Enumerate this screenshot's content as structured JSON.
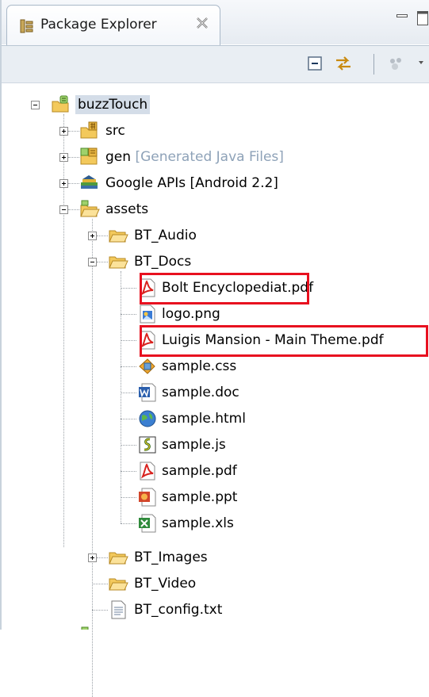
{
  "view": {
    "tab_label": "Package Explorer",
    "tab_icon": "package-explorer-icon",
    "close_icon": "close-x-icon"
  },
  "toolbar": {
    "buttons": [
      "collapse-all-icon",
      "link-with-editor-icon",
      "focus-icon",
      "view-menu-icon"
    ]
  },
  "tree": {
    "project": {
      "label": "buzzTouch",
      "icon": "android-project-icon",
      "expanded": true
    },
    "src": {
      "label": "src",
      "icon": "source-folder-icon"
    },
    "gen": {
      "label": "gen",
      "decoration": "[Generated Java Files]",
      "icon": "source-folder-icon"
    },
    "google_apis": {
      "label": "Google APIs [Android 2.2]",
      "icon": "library-icon"
    },
    "assets": {
      "label": "assets",
      "icon": "folder-icon"
    },
    "bt_audio": {
      "label": "BT_Audio",
      "icon": "folder-icon"
    },
    "bt_docs": {
      "label": "BT_Docs",
      "icon": "folder-icon"
    },
    "files": [
      {
        "label": "Bolt Encyclopediat.pdf",
        "icon": "pdf-icon",
        "highlighted": true
      },
      {
        "label": "logo.png",
        "icon": "image-icon",
        "highlighted": false
      },
      {
        "label": "Luigis Mansion - Main Theme.pdf",
        "icon": "pdf-icon",
        "highlighted": true
      },
      {
        "label": "sample.css",
        "icon": "css-icon",
        "highlighted": false
      },
      {
        "label": "sample.doc",
        "icon": "word-doc-icon",
        "highlighted": false
      },
      {
        "label": "sample.html",
        "icon": "html-globe-icon",
        "highlighted": false
      },
      {
        "label": "sample.js",
        "icon": "script-icon",
        "highlighted": false
      },
      {
        "label": "sample.pdf",
        "icon": "pdf-icon",
        "highlighted": false
      },
      {
        "label": "sample.ppt",
        "icon": "powerpoint-icon",
        "highlighted": false
      },
      {
        "label": "sample.xls",
        "icon": "excel-icon",
        "highlighted": false
      }
    ],
    "bt_images": {
      "label": "BT_Images",
      "icon": "folder-icon"
    },
    "bt_video": {
      "label": "BT_Video",
      "icon": "folder-icon"
    },
    "bt_config": {
      "label": "BT_config.txt",
      "icon": "text-file-icon"
    }
  },
  "colors": {
    "highlight_border": "#e8101f",
    "selection": "#d4dde8",
    "decoration_text": "#8ea2b8"
  }
}
